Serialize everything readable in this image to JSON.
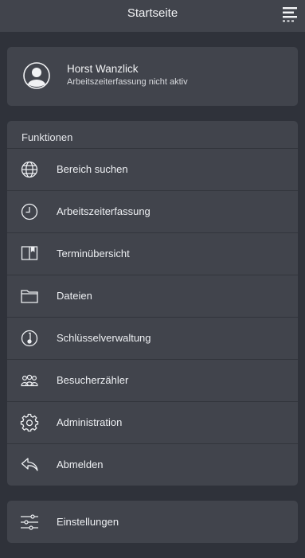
{
  "header": {
    "title": "Startseite",
    "menu_icon": "hamburger-menu-icon"
  },
  "profile": {
    "name": "Horst Wanzlick",
    "status": "Arbeitszeiterfassung nicht aktiv",
    "avatar_icon": "user-avatar-icon"
  },
  "functions": {
    "title": "Funktionen",
    "items": [
      {
        "label": "Bereich suchen",
        "icon": "globe-icon"
      },
      {
        "label": "Arbeitszeiterfassung",
        "icon": "clock-icon"
      },
      {
        "label": "Terminübersicht",
        "icon": "book-icon"
      },
      {
        "label": "Dateien",
        "icon": "folder-icon"
      },
      {
        "label": "Schlüsselverwaltung",
        "icon": "key-icon"
      },
      {
        "label": "Besucherzähler",
        "icon": "people-icon"
      },
      {
        "label": "Administration",
        "icon": "gear-icon"
      },
      {
        "label": "Abmelden",
        "icon": "reply-arrow-icon"
      }
    ]
  },
  "settings": {
    "label": "Einstellungen",
    "icon": "sliders-icon"
  }
}
